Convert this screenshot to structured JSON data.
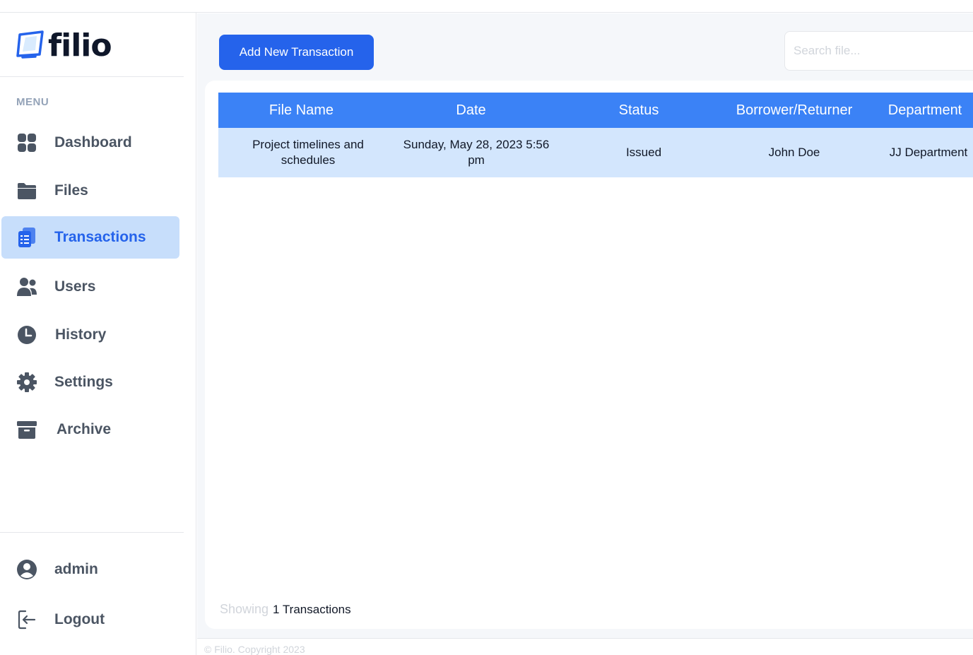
{
  "app": {
    "name": "filio"
  },
  "sidebar": {
    "menu_label": "MENU",
    "items": [
      {
        "label": "Dashboard",
        "icon": "dashboard-icon"
      },
      {
        "label": "Files",
        "icon": "folder-icon"
      },
      {
        "label": "Transactions",
        "icon": "transactions-icon",
        "active": true
      },
      {
        "label": "Users",
        "icon": "users-icon"
      },
      {
        "label": "History",
        "icon": "clock-icon"
      },
      {
        "label": "Settings",
        "icon": "gear-icon"
      },
      {
        "label": "Archive",
        "icon": "archive-icon"
      }
    ],
    "user": {
      "label": "admin",
      "icon": "user-circle-icon"
    },
    "logout": {
      "label": "Logout",
      "icon": "logout-icon"
    }
  },
  "toolbar": {
    "add_label": "Add New Transaction",
    "search_placeholder": "Search file..."
  },
  "table": {
    "headers": [
      "File Name",
      "Date",
      "Status",
      "Borrower/Returner",
      "Department"
    ],
    "rows": [
      {
        "file_name": "Project timelines and schedules",
        "date": "Sunday, May 28, 2023 5:56 pm",
        "status": "Issued",
        "borrower": "John Doe",
        "department": "JJ Department"
      }
    ]
  },
  "summary": {
    "prefix": "Showing",
    "count_text": "1 Transactions"
  },
  "footer": {
    "text": "© Filio. Copyright 2023"
  },
  "colors": {
    "accent": "#2563eb",
    "table_header": "#3b82f6",
    "row_bg": "#d3e6fd",
    "active_nav_bg": "#c7defb",
    "nav_icon": "#4b5563"
  }
}
